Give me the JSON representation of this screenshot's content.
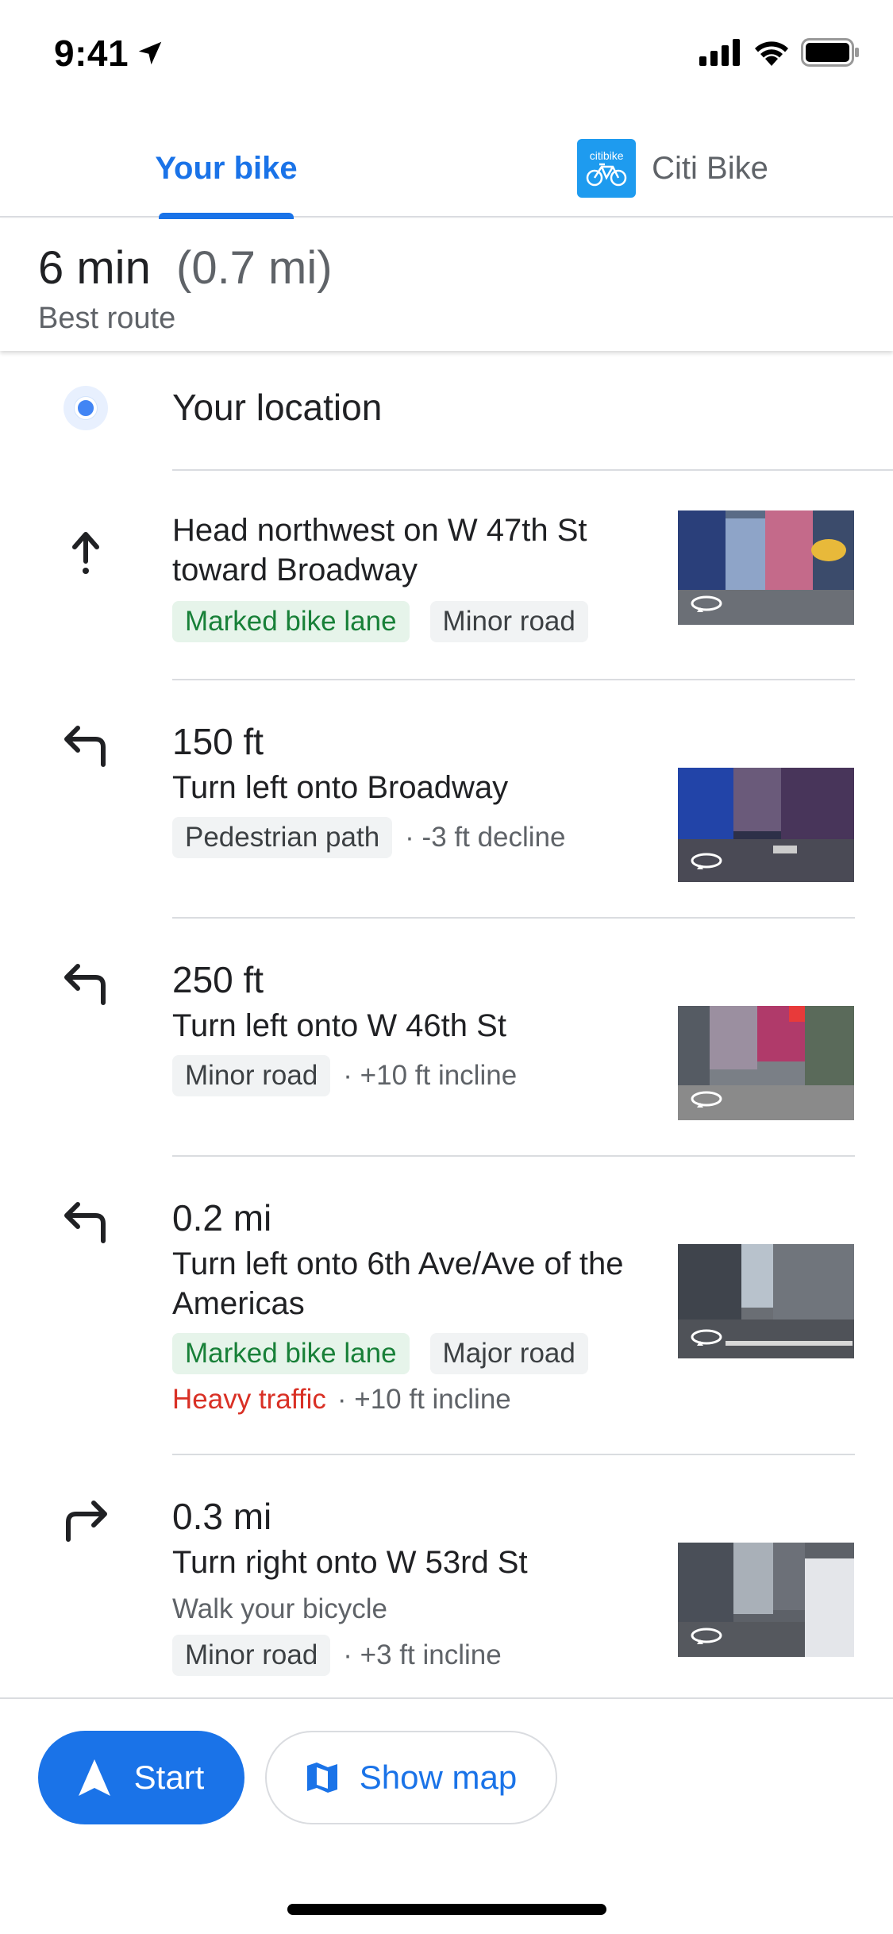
{
  "status": {
    "time": "9:41"
  },
  "tabs": [
    {
      "label": "Your bike",
      "active": true
    },
    {
      "label": "Citi Bike",
      "logo_text": "citibike",
      "active": false
    }
  ],
  "summary": {
    "time": "6 min",
    "distance": "(0.7 mi)",
    "subtitle": "Best route"
  },
  "origin": {
    "label": "Your location"
  },
  "steps": [
    {
      "icon": "arrow-up-icon",
      "distance": "",
      "instruction": "Head northwest on W 47th St toward Broadway",
      "chips": [
        "Marked bike lane",
        "Minor road"
      ],
      "extra": ""
    },
    {
      "icon": "turn-left-icon",
      "distance": "150 ft",
      "instruction": "Turn left onto Broadway",
      "chips": [
        "Pedestrian path"
      ],
      "extra": "· -3 ft decline"
    },
    {
      "icon": "turn-left-icon",
      "distance": "250 ft",
      "instruction": "Turn left onto W 46th St",
      "chips": [
        "Minor road"
      ],
      "extra": "· +10 ft incline"
    },
    {
      "icon": "turn-left-icon",
      "distance": "0.2 mi",
      "instruction": "Turn left onto 6th Ave/Ave of the Americas",
      "chips": [
        "Marked bike lane",
        "Major road"
      ],
      "traffic": "Heavy traffic",
      "extra": "· +10 ft incline"
    },
    {
      "icon": "turn-right-icon",
      "distance": "0.3 mi",
      "instruction": "Turn right onto W 53rd St",
      "note": "Walk your bicycle",
      "chips": [
        "Minor road"
      ],
      "extra": "· +3 ft incline"
    }
  ],
  "actions": {
    "start": "Start",
    "show_map": "Show map"
  },
  "colors": {
    "accent": "#1a73e8",
    "green": "#188038",
    "traffic": "#d93025",
    "citi": "#1e9bef"
  }
}
